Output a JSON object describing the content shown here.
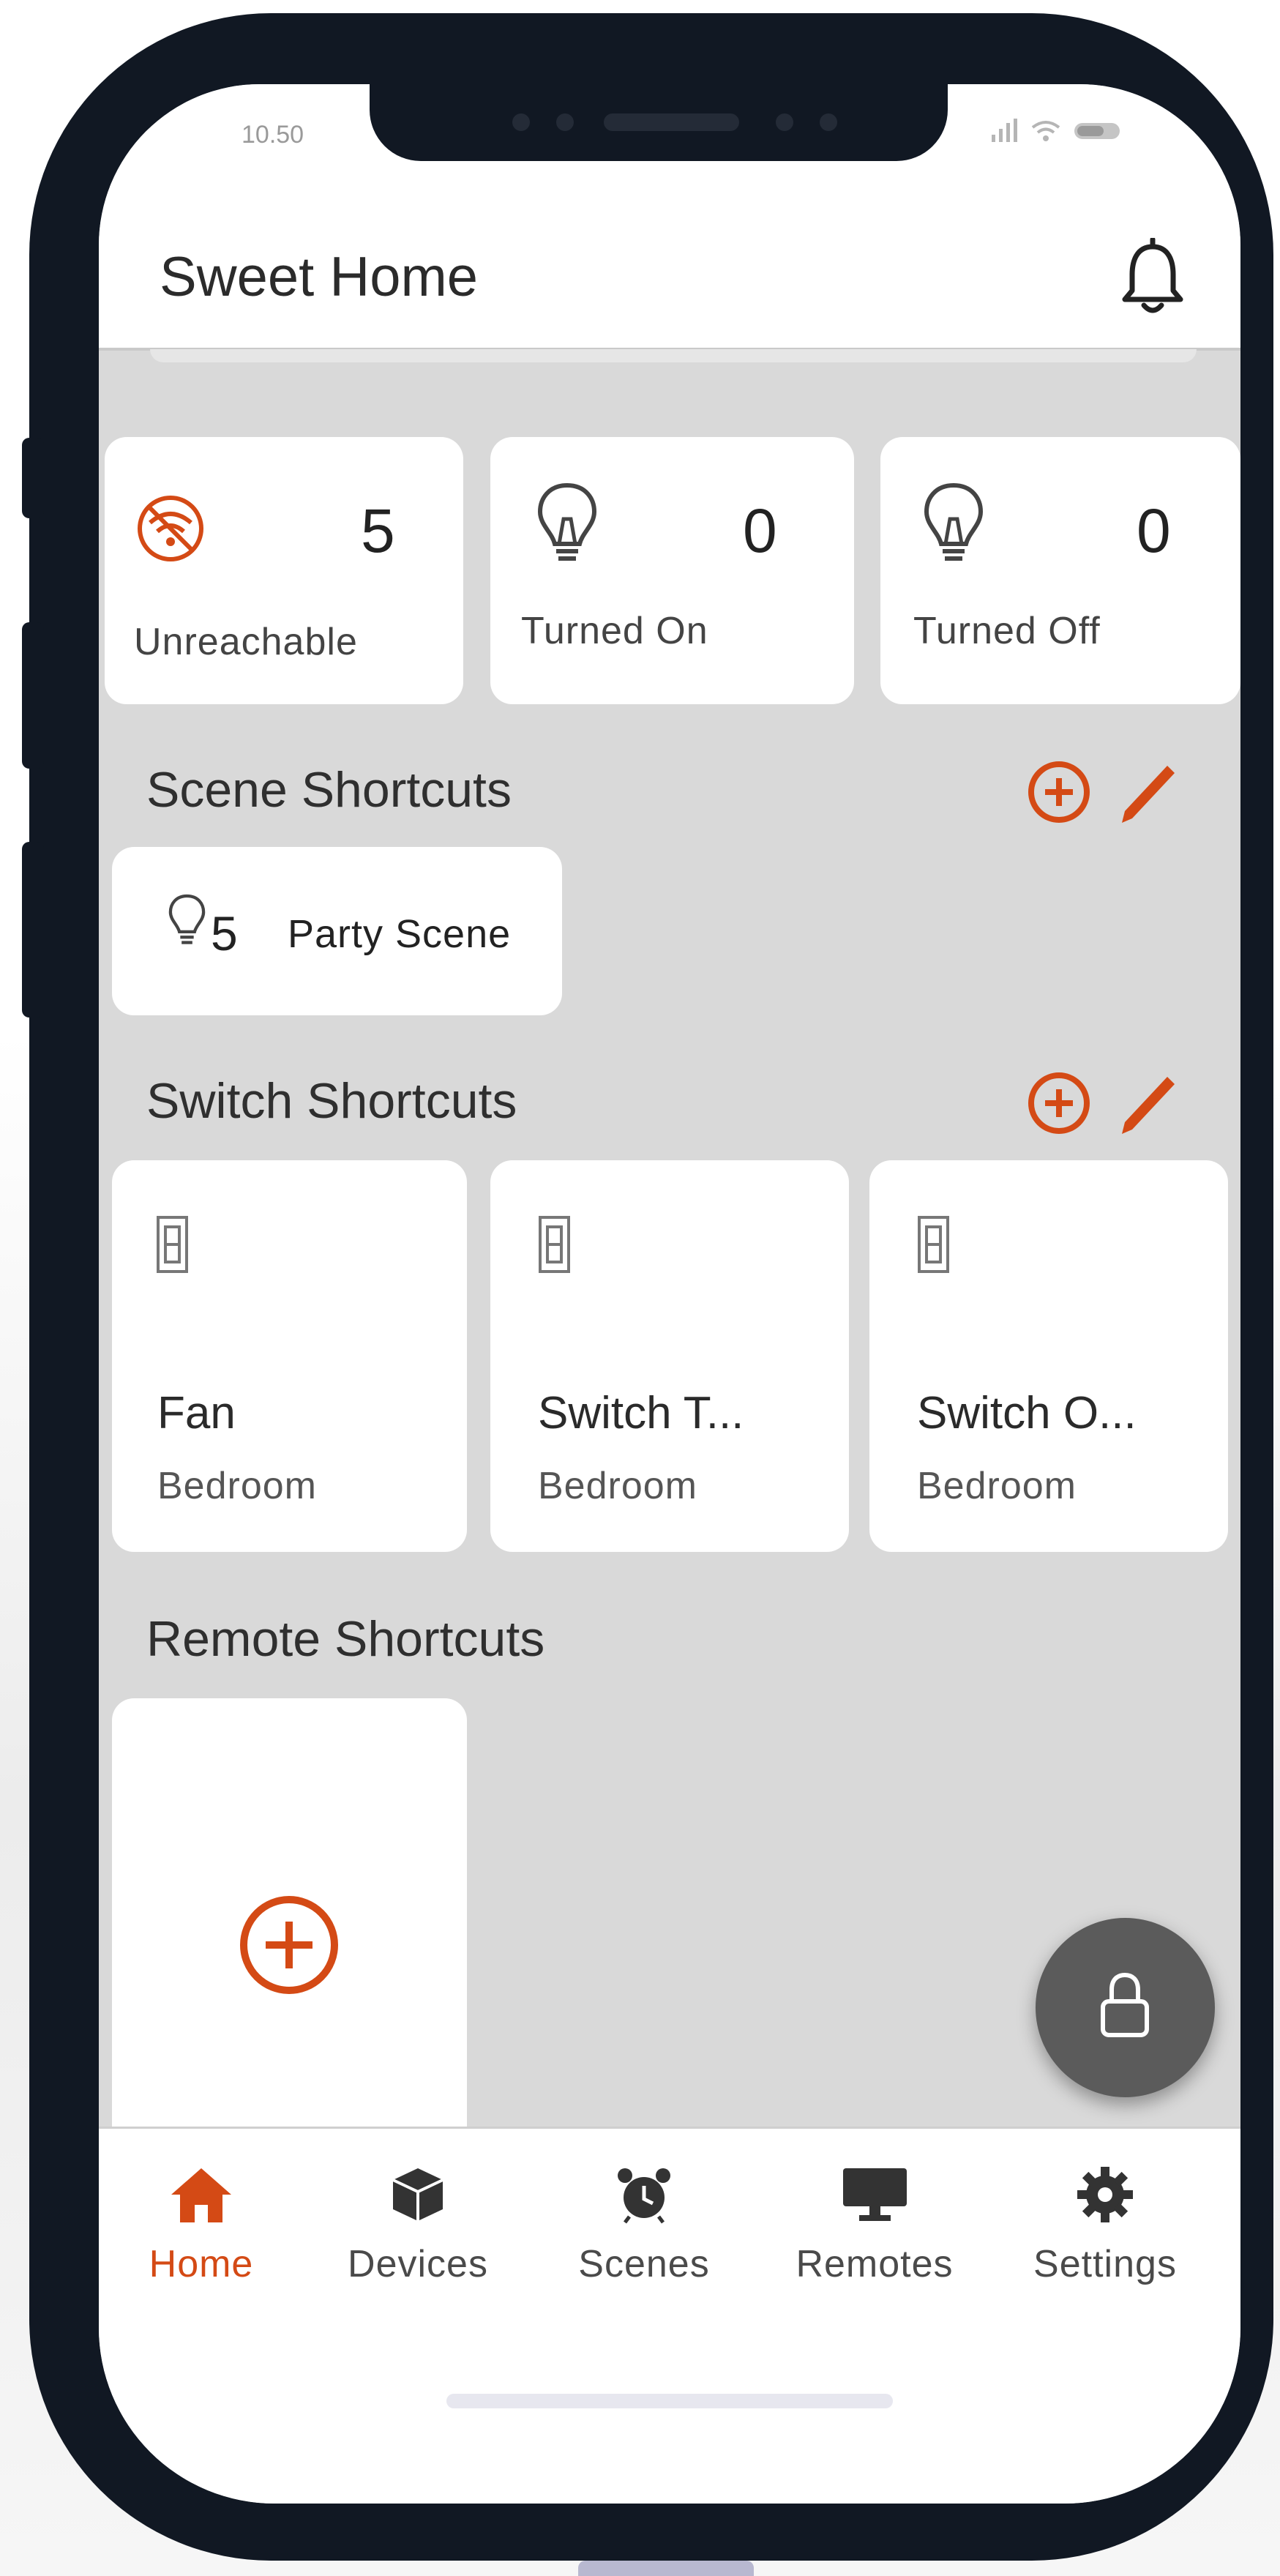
{
  "status_bar": {
    "time": "10.50"
  },
  "header": {
    "title": "Sweet Home"
  },
  "stats": [
    {
      "count": "5",
      "label": "Unreachable",
      "icon": "wifi-off-icon"
    },
    {
      "count": "0",
      "label": "Turned On",
      "icon": "bulb-icon"
    },
    {
      "count": "0",
      "label": "Turned Off",
      "icon": "bulb-icon"
    }
  ],
  "scene_section": {
    "title": "Scene Shortcuts",
    "scenes": [
      {
        "count": "5",
        "name": "Party Scene"
      }
    ]
  },
  "switch_section": {
    "title": "Switch Shortcuts",
    "switches": [
      {
        "name": "Fan",
        "room": "Bedroom"
      },
      {
        "name": "Switch T...",
        "room": "Bedroom"
      },
      {
        "name": "Switch O...",
        "room": "Bedroom"
      }
    ]
  },
  "remote_section": {
    "title": "Remote Shortcuts"
  },
  "nav": {
    "items": [
      {
        "label": "Home",
        "icon": "home-icon",
        "active": true
      },
      {
        "label": "Devices",
        "icon": "cube-icon"
      },
      {
        "label": "Scenes",
        "icon": "alarm-clock-icon"
      },
      {
        "label": "Remotes",
        "icon": "monitor-icon"
      },
      {
        "label": "Settings",
        "icon": "gear-icon"
      }
    ]
  },
  "colors": {
    "accent": "#d44a15",
    "frame": "#111823",
    "background": "#d9d9d9",
    "fab": "#5b5b5b"
  }
}
